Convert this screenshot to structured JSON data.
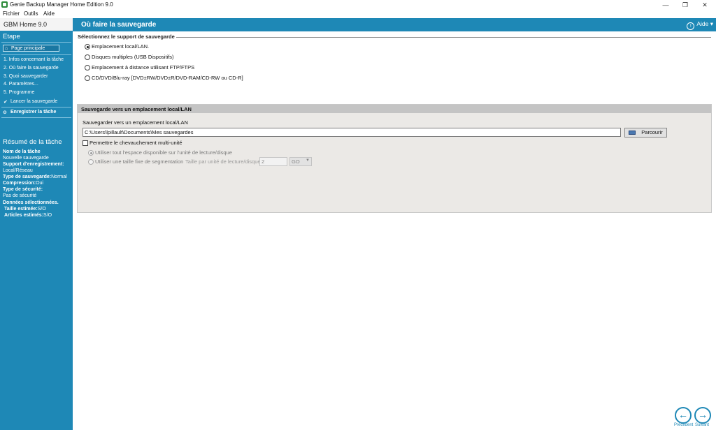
{
  "window": {
    "title": "Genie Backup Manager Home Edition 9.0",
    "minimize": "—",
    "maximize": "❐",
    "close": "✕"
  },
  "menu": [
    "Fichier",
    "Outils",
    "Aide"
  ],
  "sidebar": {
    "app_name": "GBM Home 9.0",
    "step_heading": "Etape",
    "home": "Page principale",
    "steps": [
      "1. Infos concernant la tâche",
      "2. Où faire la sauvegarde",
      "3. Quoi sauvegarder",
      "4. Paramètres...",
      "5. Programme"
    ],
    "launch": "Lancer la sauvegarde",
    "save_task": "Enregistrer la tâche",
    "summary_heading": "Résumé de la tâche",
    "summary": {
      "task_name_label": "Nom de la tâche",
      "task_name_value": "Nouvelle sauvegarde",
      "storage_label": "Support d'enregistrement:",
      "storage_value": "Local/Réseau",
      "backup_type_label": "Type de sauvegarde:",
      "backup_type_value": "Normal",
      "compression_label": "Compression:",
      "compression_value": "Oui",
      "security_label": "Type de sécurité:",
      "security_value": "Pas de sécurité",
      "data_label": "Données sélectionnées.",
      "size_label": "Taille estimée:",
      "size_value": "S/O",
      "items_label": "Articles estimés:",
      "items_value": "S/O"
    }
  },
  "main": {
    "title": "Où faire la sauvegarde",
    "help": "Aide",
    "group_label": "Sélectionnez le support de sauvegarde",
    "options": [
      "Emplacement local/LAN.",
      "Disques multiples (USB Dispositifs)",
      "Emplacement à distance utilisant FTP/FTPS",
      "CD/DVD/Blu-ray [DVD±RW/DVD±R/DVD-RAM/CD-RW ou CD-R]"
    ],
    "selected_option": 0,
    "panel": {
      "heading": "Sauvegarde vers un emplacement local/LAN",
      "path_label": "Sauvegarder vers un emplacement local/LAN",
      "path_value": "C:\\Users\\lpillault\\Documents\\Mes sauvegardes",
      "browse": "Parcourir",
      "multi_unit_label": "Permettre le chevauchement multi-unité",
      "multi_unit_checked": false,
      "use_all_space": "Utiliser tout l'espace disponible sur l'unité de lecture/disque",
      "fixed_size": "Utiliser une taille fixe de segmentation",
      "segment_label": "Taille par unité de lecture/disque:",
      "segment_value": "2",
      "unit_value": "GO"
    }
  },
  "nav": {
    "prev_label": "Précédent",
    "next_label": "Suivant"
  },
  "colors": {
    "accent": "#1e88b6",
    "panel_bg": "#ebe9e6",
    "panel_head": "#c4c4c4"
  }
}
